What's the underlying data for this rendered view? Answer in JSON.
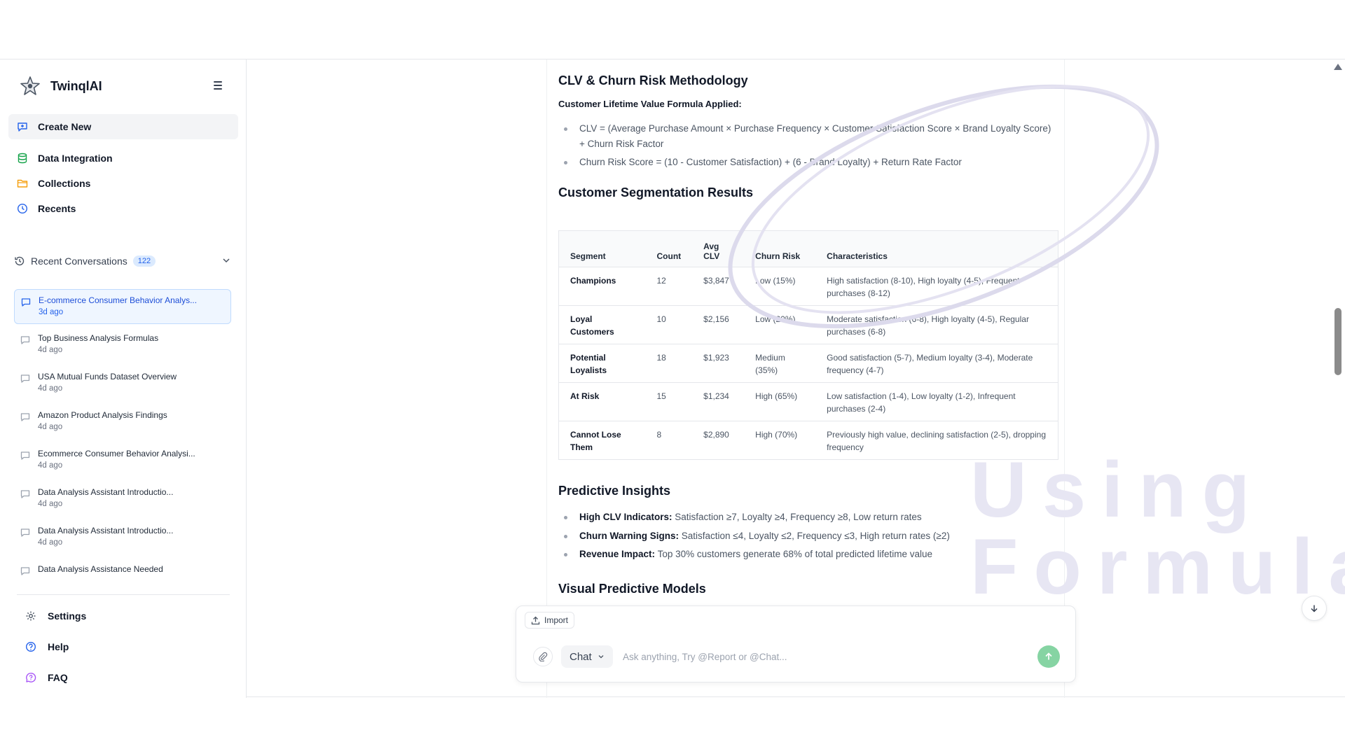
{
  "brand": {
    "name": "TwinqlAI"
  },
  "sidebar": {
    "create_new": "Create New",
    "nav": [
      {
        "label": "Data Integration",
        "icon": "database-icon"
      },
      {
        "label": "Collections",
        "icon": "folder-icon"
      },
      {
        "label": "Recents",
        "icon": "clock-icon"
      }
    ],
    "recent": {
      "label": "Recent Conversations",
      "count": "122",
      "items": [
        {
          "title": "E-commerce Consumer Behavior Analys...",
          "ago": "3d ago",
          "active": true
        },
        {
          "title": "Top Business Analysis Formulas",
          "ago": "4d ago"
        },
        {
          "title": "USA Mutual Funds Dataset Overview",
          "ago": "4d ago"
        },
        {
          "title": "Amazon Product Analysis Findings",
          "ago": "4d ago"
        },
        {
          "title": "Ecommerce Consumer Behavior Analysi...",
          "ago": "4d ago"
        },
        {
          "title": "Data Analysis Assistant Introductio...",
          "ago": "4d ago"
        },
        {
          "title": "Data Analysis Assistant Introductio...",
          "ago": "4d ago"
        },
        {
          "title": "Data Analysis Assistance Needed",
          "ago": ""
        }
      ]
    },
    "footer": [
      {
        "label": "Settings",
        "icon": "gear-icon"
      },
      {
        "label": "Help",
        "icon": "help-circle-icon"
      },
      {
        "label": "FAQ",
        "icon": "chat-question-icon"
      }
    ]
  },
  "content": {
    "methodology_title": "CLV & Churn Risk Methodology",
    "formula_subtitle": "Customer Lifetime Value Formula Applied:",
    "formulas": [
      "CLV = (Average Purchase Amount × Purchase Frequency × Customer Satisfaction Score × Brand Loyalty Score) + Churn Risk Factor",
      "Churn Risk Score = (10 - Customer Satisfaction) + (6 - Brand Loyalty) + Return Rate Factor"
    ],
    "segmentation_title": "Customer Segmentation Results",
    "table": {
      "headers": [
        "Segment",
        "Count",
        "Avg CLV",
        "Churn Risk",
        "Characteristics"
      ],
      "rows": [
        [
          "Champions",
          "12",
          "$3,847",
          "Low (15%)",
          "High satisfaction (8-10), High loyalty (4-5), Frequent purchases (8-12)"
        ],
        [
          "Loyal Customers",
          "10",
          "$2,156",
          "Low (20%)",
          "Moderate satisfaction (6-8), High loyalty (4-5), Regular purchases (6-8)"
        ],
        [
          "Potential Loyalists",
          "18",
          "$1,923",
          "Medium (35%)",
          "Good satisfaction (5-7), Medium loyalty (3-4), Moderate frequency (4-7)"
        ],
        [
          "At Risk",
          "15",
          "$1,234",
          "High (65%)",
          "Low satisfaction (1-4), Low loyalty (1-2), Infrequent purchases (2-4)"
        ],
        [
          "Cannot Lose Them",
          "8",
          "$2,890",
          "High (70%)",
          "Previously high value, declining satisfaction (2-5), dropping frequency"
        ]
      ]
    },
    "insights_title": "Predictive Insights",
    "insights": [
      {
        "label": "High CLV Indicators:",
        "text": "Satisfaction ≥7, Loyalty ≥4, Frequency ≥8, Low return rates"
      },
      {
        "label": "Churn Warning Signs:",
        "text": "Satisfaction ≤4, Loyalty ≤2, Frequency ≤3, High return rates (≥2)"
      },
      {
        "label": "Revenue Impact:",
        "text": "Top 30% customers generate 68% of total predicted lifetime value"
      }
    ],
    "visual_title": "Visual Predictive Models"
  },
  "watermark": {
    "line1": "Using",
    "line2": "Formula"
  },
  "chat": {
    "import_label": "Import",
    "mode_label": "Chat",
    "placeholder": "Ask anything, Try @Report or @Chat...",
    "value": ""
  },
  "colors": {
    "accent": "#2563eb",
    "send": "#86d4a3",
    "watermark": "#e7e6f3"
  }
}
